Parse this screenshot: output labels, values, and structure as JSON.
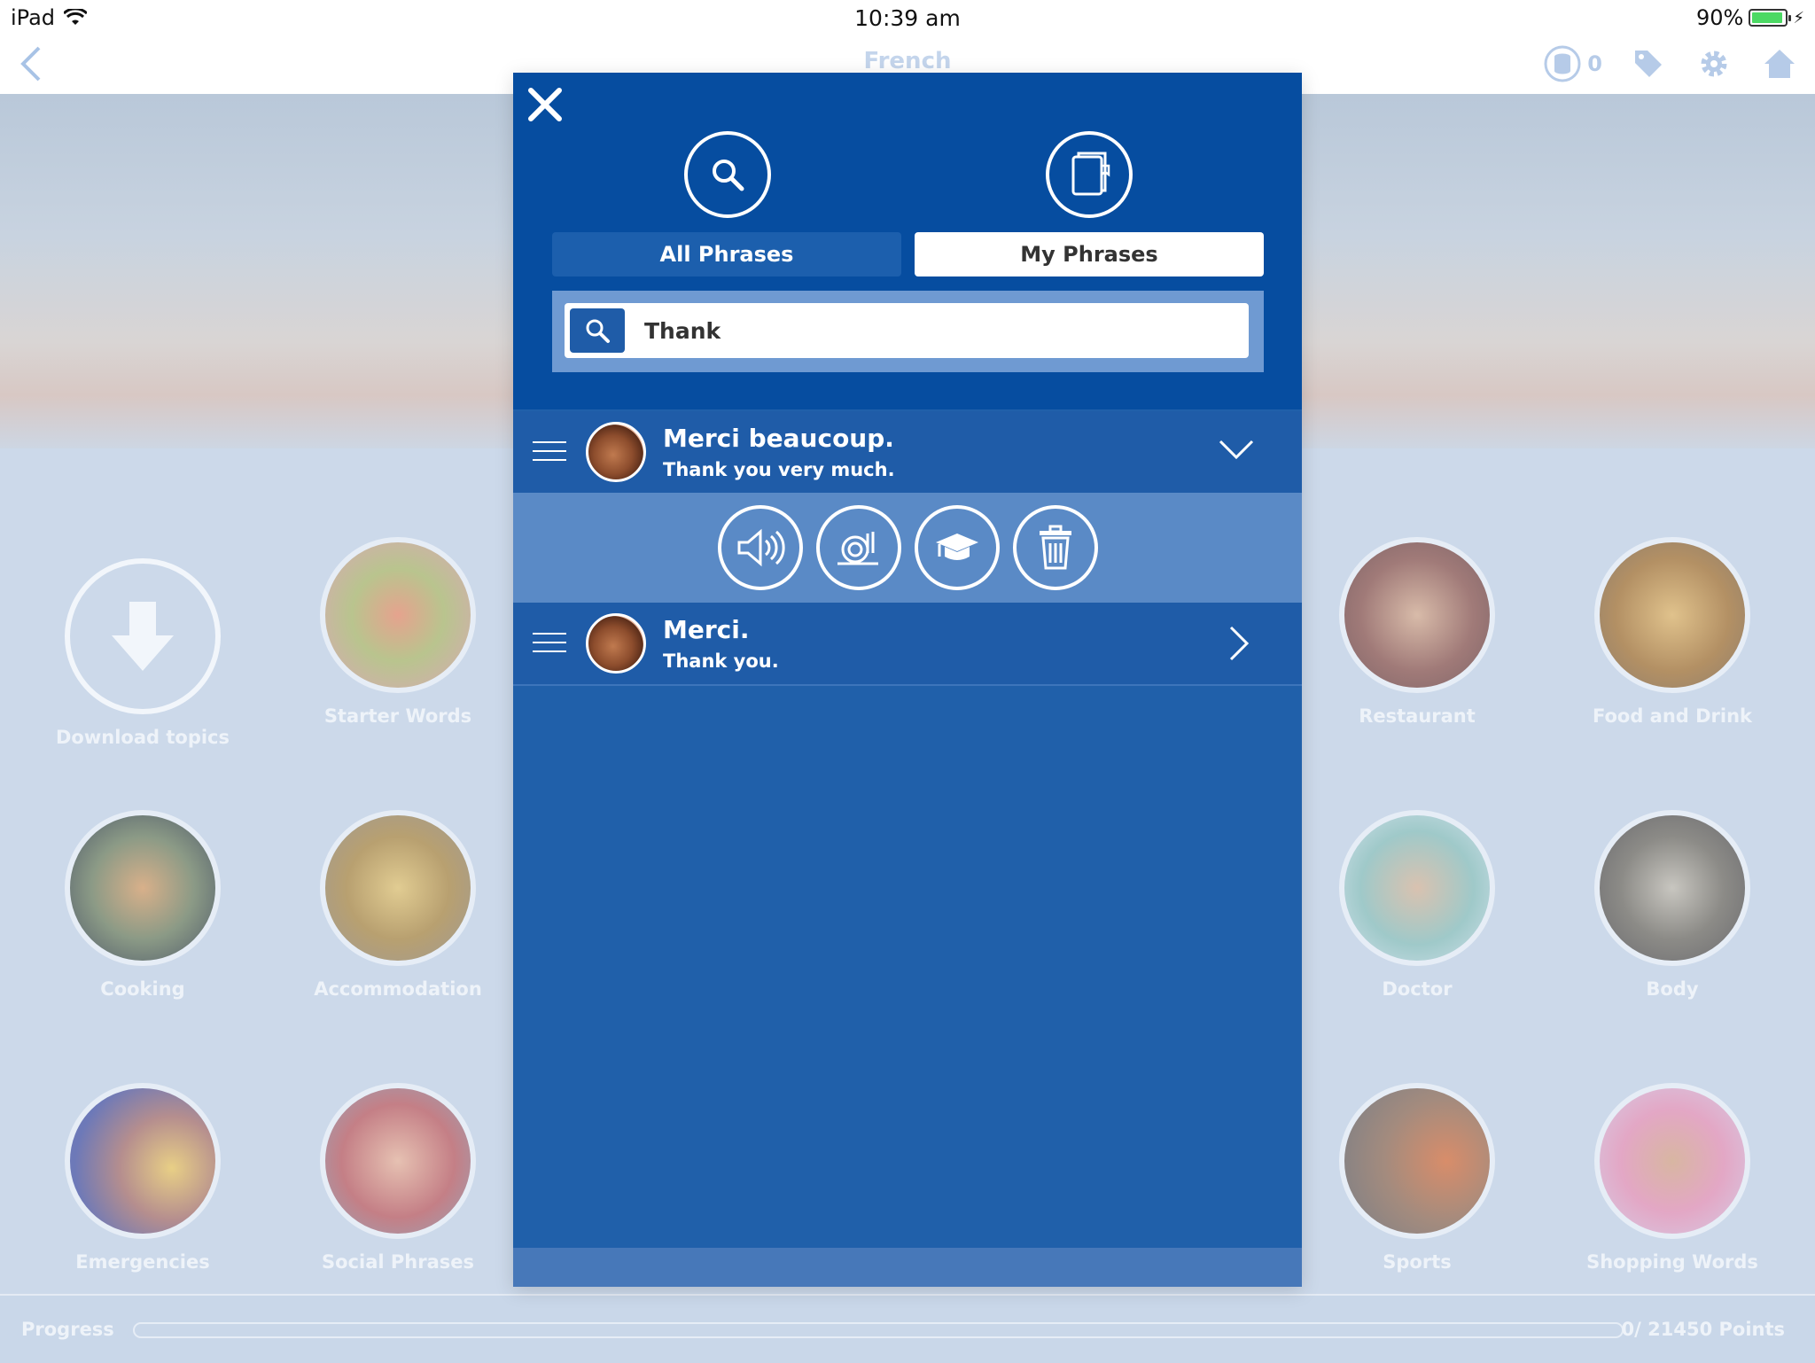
{
  "status_bar": {
    "device": "iPad",
    "time": "10:39 am",
    "battery": "90%"
  },
  "nav": {
    "title": "French",
    "coins": "0"
  },
  "topics": [
    {
      "label": "Download topics",
      "color": "#cfdcec"
    },
    {
      "label": "Starter Words",
      "color": "#d9b7a8"
    },
    {
      "label": "Restaurant",
      "color": "#b99592"
    },
    {
      "label": "Food and Drink",
      "color": "#c7a98c"
    },
    {
      "label": "Cooking",
      "color": "#a7a9a0"
    },
    {
      "label": "Accommodation",
      "color": "#c2b08a"
    },
    {
      "label": "Doctor",
      "color": "#b7cfd5"
    },
    {
      "label": "Body",
      "color": "#9d9e9e"
    },
    {
      "label": "Emergencies",
      "color": "#9fa2c4"
    },
    {
      "label": "Social Phrases",
      "color": "#c99ea3"
    },
    {
      "label": "Sports",
      "color": "#b4a39a"
    },
    {
      "label": "Shopping Words",
      "color": "#d7b6c9"
    }
  ],
  "progress": {
    "label": "Progress",
    "points": "0/ 21450 Points",
    "fraction": 0
  },
  "modal": {
    "tabs": {
      "all": "All Phrases",
      "mine": "My Phrases",
      "selected": "My Phrases"
    },
    "search": {
      "value": "Thank",
      "placeholder": ""
    },
    "phrases": [
      {
        "french": "Merci beaucoup.",
        "english": "Thank you very much.",
        "expanded": true
      },
      {
        "french": "Merci.",
        "english": "Thank you.",
        "expanded": false
      }
    ],
    "actions": [
      "speaker-icon",
      "slow-snail-icon",
      "learn-graduation-cap-icon",
      "trash-icon"
    ]
  },
  "colors": {
    "modal_blue": "#2060aa",
    "header_blue": "#064da0",
    "action_bar": "#5a8ac6"
  }
}
